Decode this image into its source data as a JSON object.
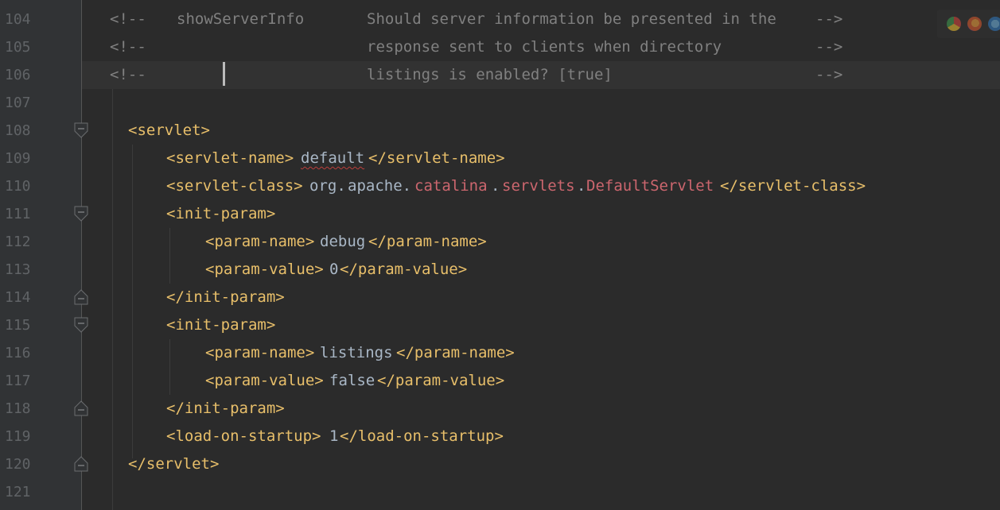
{
  "editor": {
    "line_numbers": [
      "104",
      "105",
      "106",
      "107",
      "108",
      "109",
      "110",
      "111",
      "112",
      "113",
      "114",
      "115",
      "116",
      "117",
      "118",
      "119",
      "120",
      "121"
    ],
    "comment_open": "<!--",
    "comment_close": "-->",
    "comment_param_name": "showServerInfo",
    "comment_desc_1": "Should server information be presented in the",
    "comment_desc_2": "response sent to clients when directory",
    "comment_desc_3": "listings is enabled? [true]",
    "servlet_open": "<servlet>",
    "servlet_close": "</servlet>",
    "servlet_name_open": "<servlet-name>",
    "servlet_name_value": "default",
    "servlet_name_close": "</servlet-name>",
    "servlet_class_open": "<servlet-class>",
    "servlet_class_pkg_a": "org.",
    "servlet_class_pkg_b": "apache.",
    "servlet_class_pkg_c": "catalina",
    "servlet_class_dot_1": ".",
    "servlet_class_pkg_d": "servlets",
    "servlet_class_dot_2": ".",
    "servlet_class_cls": "DefaultServlet",
    "servlet_class_close": "</servlet-class>",
    "init_param_open": "<init-param>",
    "init_param_close": "</init-param>",
    "param_name_open": "<param-name>",
    "param_name_close": "</param-name>",
    "param_value_open": "<param-value>",
    "param_value_close": "</param-value>",
    "param1_name": "debug",
    "param1_value": "0",
    "param2_name": "listings",
    "param2_value": "false",
    "load_open": "<load-on-startup>",
    "load_value": "1",
    "load_close": "</load-on-startup>"
  },
  "browser_icons": [
    "chrome-icon",
    "firefox-icon",
    "edge-icon"
  ],
  "colors": {
    "background": "#2b2b2b",
    "gutter": "#313335",
    "line_number": "#606366",
    "comment": "#808080",
    "tag": "#e8bf6a",
    "text": "#a9b7c6",
    "class_ref": "#cc666e"
  }
}
